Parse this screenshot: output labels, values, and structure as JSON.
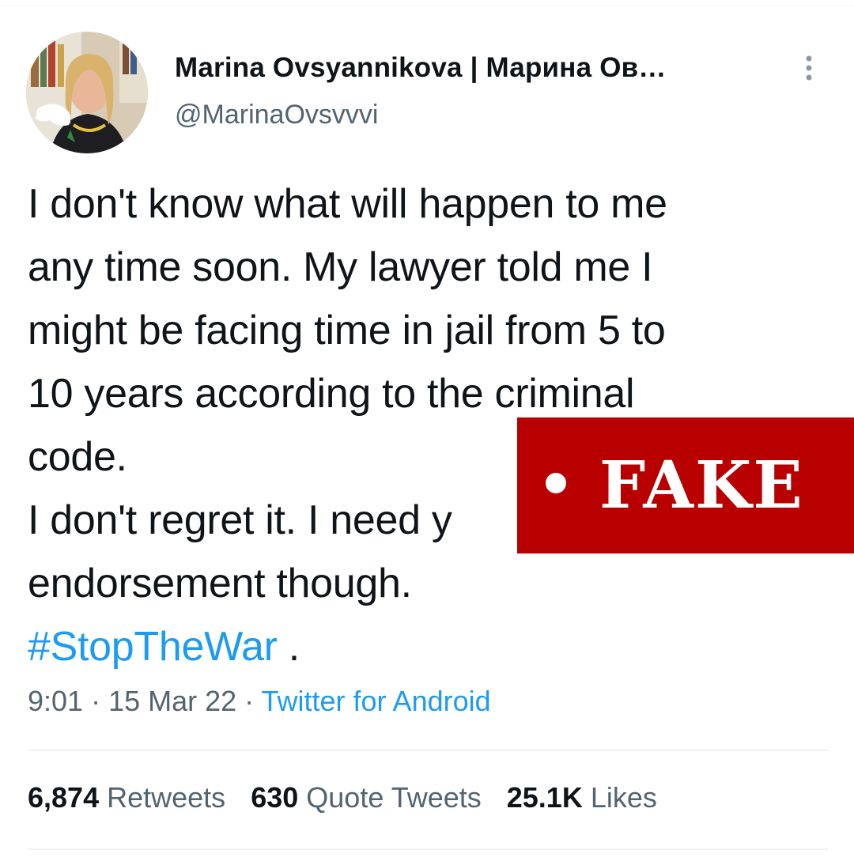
{
  "author": {
    "display_name": "Marina Ovsyannikova | Марина Ов…",
    "handle": "@MarinaOvsvvvi"
  },
  "tweet": {
    "lines": [
      "I don't know what will happen to me",
      "any time soon. My lawyer told me I",
      "might be facing time in jail from 5 to",
      "10 years according to the criminal",
      "code.",
      "I don't regret it. I need y",
      "endorsement though."
    ],
    "hashtag": "#StopTheWar",
    "trailing": " ."
  },
  "meta": {
    "time": "9:01",
    "sep1": " · ",
    "date": "15 Mar 22",
    "sep2": " · ",
    "source": "Twitter for Android"
  },
  "stats": {
    "retweets_count": "6,874",
    "retweets_label": "Retweets",
    "quotes_count": "630",
    "quotes_label": "Quote Tweets",
    "likes_count": "25.1K",
    "likes_label": "Likes"
  },
  "overlay": {
    "stamp_text": "FAKE"
  },
  "colors": {
    "text": "#0f1419",
    "secondary": "#536471",
    "link": "#1d9bf0",
    "stamp": "#b80000",
    "divider": "#eff3f4"
  },
  "icons": {
    "more": "more-vertical-icon"
  }
}
